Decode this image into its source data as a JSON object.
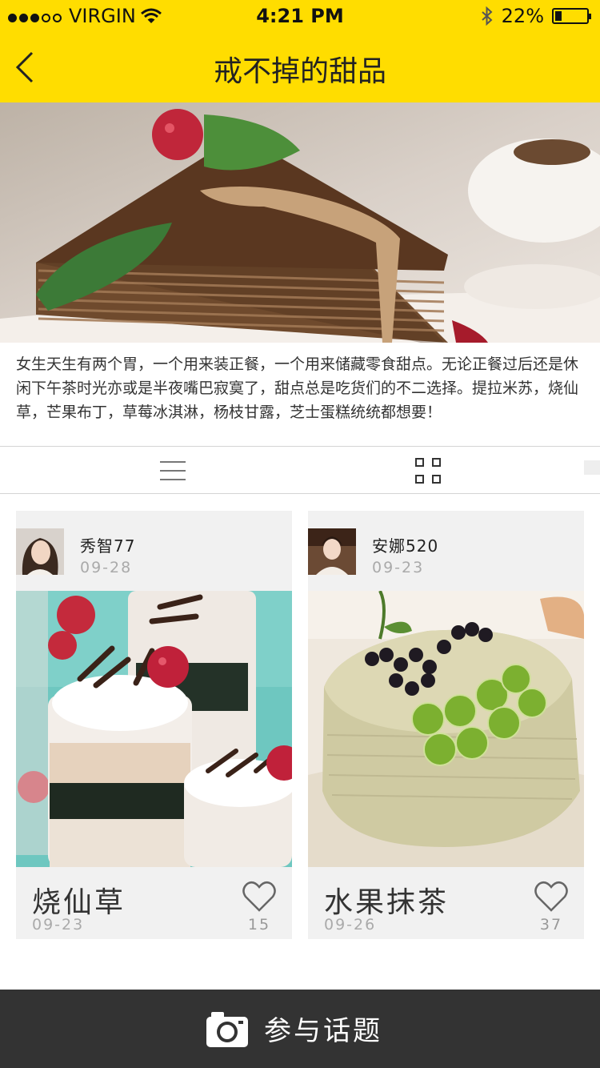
{
  "status_bar": {
    "carrier": "VIRGIN",
    "time": "4:21 PM",
    "battery": "22%",
    "battery_level": 0.22,
    "signal_bars_filled": 3,
    "signal_bars_total": 5
  },
  "nav": {
    "title": "戒不掉的甜品",
    "back_icon": "chevron-left-icon"
  },
  "hero": {
    "image": "chocolate-layer-cake-photo"
  },
  "description": "女生天生有两个胃，一个用来装正餐，一个用来储藏零食甜点。无论正餐过后还是休闲下午茶时光亦或是半夜嘴巴寂寞了，甜点总是吃货们的不二选择。提拉米苏，烧仙草，芒果布丁，草莓冰淇淋，杨枝甘露，芝士蛋糕统统都想要！",
  "view_toggle": {
    "list_icon": "list-view-icon",
    "grid_icon": "grid-view-icon"
  },
  "cards": [
    {
      "user": "秀智77",
      "user_date": "09-28",
      "name": "烧仙草",
      "date": "09-23",
      "likes": "15",
      "image": "layered-dessert-cups-photo"
    },
    {
      "user": "安娜520",
      "user_date": "09-23",
      "name": "水果抹茶",
      "date": "09-26",
      "likes": "37",
      "image": "kiwi-heart-cake-photo"
    }
  ],
  "footer": {
    "label": "参与话题",
    "icon": "camera-icon"
  },
  "colors": {
    "accent": "#FFDD00",
    "footer": "#333333",
    "card_bg": "#F1F1F1"
  }
}
